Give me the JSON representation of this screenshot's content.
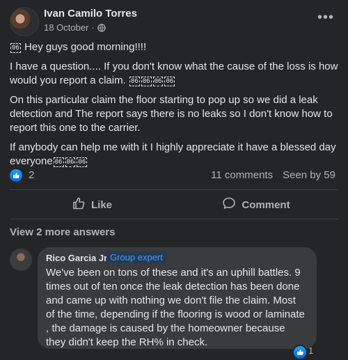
{
  "post": {
    "author": "Ivan Camilo Torres",
    "date": "18 October",
    "separator": "·",
    "paragraphs": {
      "p1": "Hey guys good morning!!!!",
      "p2": "I have a question.... If you don't know what the cause of the loss is how would you report a claim.",
      "p3": "On this particular claim the floor starting to pop up so we did a leak detection and The report says there is no leaks so I don't know how to report this one to the carrier.",
      "p4": "If anybody can help me with it I highly appreciate it have a blessed day everyone"
    },
    "missing_glyph": "06"
  },
  "stats": {
    "reaction_count": "2",
    "comments": "11 comments",
    "seen_by": "Seen by 59"
  },
  "actions": {
    "like": "Like",
    "comment": "Comment"
  },
  "view_more": "View 2 more answers",
  "comment": {
    "author": "Rico Garcia Jr.",
    "badge": "Group expert",
    "text": "We've been on tons of these and it's an uphill battles. 9 times out of ten once the leak detection has been done and came up with nothing we don't file the claim. Most of the time, depending if the flooring is wood or laminate , the damage is caused by the homeowner because they didn't keep the RH% in check.",
    "reaction_count": "1"
  },
  "colors": {
    "background": "#242526",
    "bubble": "#3a3b3c",
    "text": "#e4e6eb",
    "secondary_text": "#b0b3b8",
    "like_blue": "#0566e8",
    "badge_blue": "#4599ff"
  },
  "icons": [
    "globe-icon",
    "more-options-icon",
    "like-reaction-icon",
    "like-outline-icon",
    "comment-icon"
  ]
}
